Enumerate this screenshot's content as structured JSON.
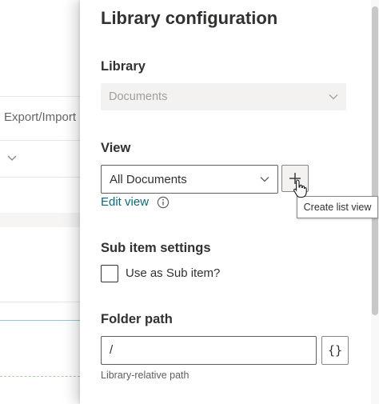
{
  "background": {
    "column_header": "Export/Import"
  },
  "panel": {
    "title": "Library configuration",
    "library": {
      "label": "Library",
      "selected": "Documents"
    },
    "view": {
      "label": "View",
      "selected": "All Documents",
      "add_tooltip": "Create list view",
      "edit_link": "Edit view"
    },
    "sub_item": {
      "label": "Sub item settings",
      "checkbox_label": "Use as Sub item?",
      "checked": false
    },
    "folder_path": {
      "label": "Folder path",
      "value": "/",
      "braces_label": "{}",
      "helper": "Library-relative path"
    }
  },
  "colors": {
    "link": "#0b6a7a",
    "disabled_bg": "#f3f2f1",
    "disabled_text": "#a19f9d"
  },
  "icons": [
    "chevron-down-icon",
    "plus-icon",
    "info-icon",
    "pointer-cursor-icon",
    "braces-icon"
  ]
}
